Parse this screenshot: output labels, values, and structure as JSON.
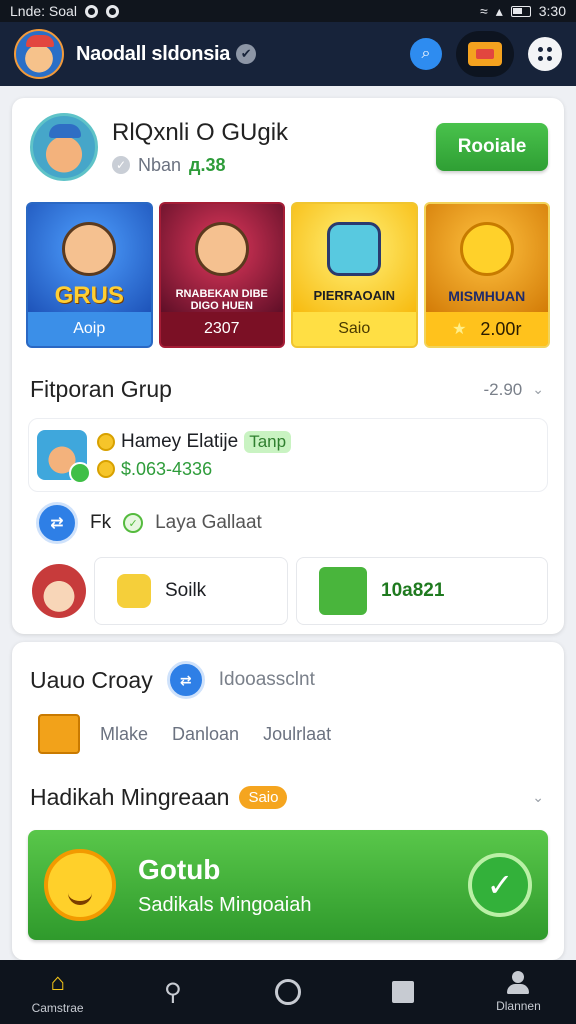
{
  "status": {
    "left_text": "Lnde: Soal",
    "time": "3:30"
  },
  "appbar": {
    "title": "Naodall sldonsia",
    "verified_glyph": "✔",
    "search_glyph": "⌕"
  },
  "profile": {
    "name": "RlQxnli O GUgik",
    "sub_label": "Nban",
    "sub_points": "д.38",
    "action_label": "Rooiale"
  },
  "tiles": [
    {
      "label": "GRUS",
      "footer": "Aoip",
      "color": "#2d6fd0"
    },
    {
      "label": "RNABEKAN DIBE DIGO HUEN",
      "footer": "2307",
      "color": "#b01f3a"
    },
    {
      "label": "PIERRAOAIN",
      "footer": "Saio",
      "color": "#ffd233"
    },
    {
      "label": "MISMHUAN",
      "footer": "2.00r",
      "color": "#f5a91c"
    }
  ],
  "group_section": {
    "title": "Fitporan Grup",
    "meta": "-2.90",
    "item1": {
      "name": "Hamey Elatije",
      "tag": "Tanp",
      "value": "$.063-4336"
    },
    "item2": {
      "prefix": "Fk",
      "text": "Laya Gallaat"
    },
    "mini1": {
      "label": "Soilk"
    },
    "mini2": {
      "value": "10a821"
    }
  },
  "card2": {
    "title": "Uauo Croay",
    "badge_text": "Idooassclnt",
    "links": [
      "Mlake",
      "Danloan",
      "Joulrlaat"
    ],
    "reward_title": "Hadikah Mingreaan",
    "reward_pill": "Saio",
    "banner_title": "Gotub",
    "banner_sub": "Sadikals Mingoaiah"
  },
  "bottom_nav": [
    {
      "label": "Camstrae",
      "icon": "home-icon"
    },
    {
      "label": "",
      "icon": "search-icon"
    },
    {
      "label": "",
      "icon": "circle-icon"
    },
    {
      "label": "",
      "icon": "square-icon"
    },
    {
      "label": "Dlannen",
      "icon": "person-icon"
    }
  ],
  "colors": {
    "accent_green": "#2f9f34",
    "appbar": "#17233a",
    "link_blue": "#2e8cf0"
  }
}
